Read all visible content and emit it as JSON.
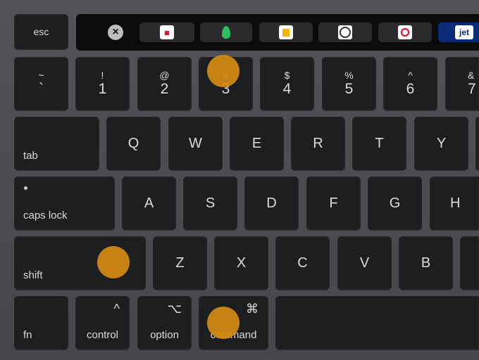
{
  "touchbar": {
    "close_icon": "close-circle-icon",
    "apps": [
      {
        "name": "news-app-icon",
        "label": "",
        "color": "#c8102e"
      },
      {
        "name": "evernote-leaf-icon",
        "color": "#2dbe60"
      },
      {
        "name": "mug-app-icon",
        "color": "#f5b400"
      },
      {
        "name": "circle-logo-app-icon",
        "color": "#333333"
      },
      {
        "name": "record-app-icon",
        "color": "#e6002d"
      },
      {
        "name": "jet-app-icon",
        "label": "jet",
        "color": "#0b2a7a"
      }
    ]
  },
  "keys": {
    "esc": "esc",
    "tilde": {
      "top": "~",
      "bottom": "`"
    },
    "n1": {
      "top": "!",
      "bottom": "1"
    },
    "n2": {
      "top": "@",
      "bottom": "2"
    },
    "n3": {
      "top": "#",
      "bottom": "3"
    },
    "n4": {
      "top": "$",
      "bottom": "4"
    },
    "n5": {
      "top": "%",
      "bottom": "5"
    },
    "n6": {
      "top": "^",
      "bottom": "6"
    },
    "n7": {
      "top": "&",
      "bottom": "7"
    },
    "tab": "tab",
    "q": "Q",
    "w": "W",
    "e": "E",
    "r": "R",
    "t": "T",
    "y": "Y",
    "caps": "caps lock",
    "a": "A",
    "s": "S",
    "d": "D",
    "f": "F",
    "g": "G",
    "h": "H",
    "shift": "shift",
    "z": "Z",
    "x": "X",
    "c": "C",
    "v": "V",
    "b": "B",
    "fn": "fn",
    "control": {
      "label": "control",
      "symbol": "^"
    },
    "option": {
      "label": "option",
      "symbol": "⌥"
    },
    "command": {
      "label": "command",
      "symbol": "⌘"
    }
  },
  "highlight_color": "#d38a12"
}
